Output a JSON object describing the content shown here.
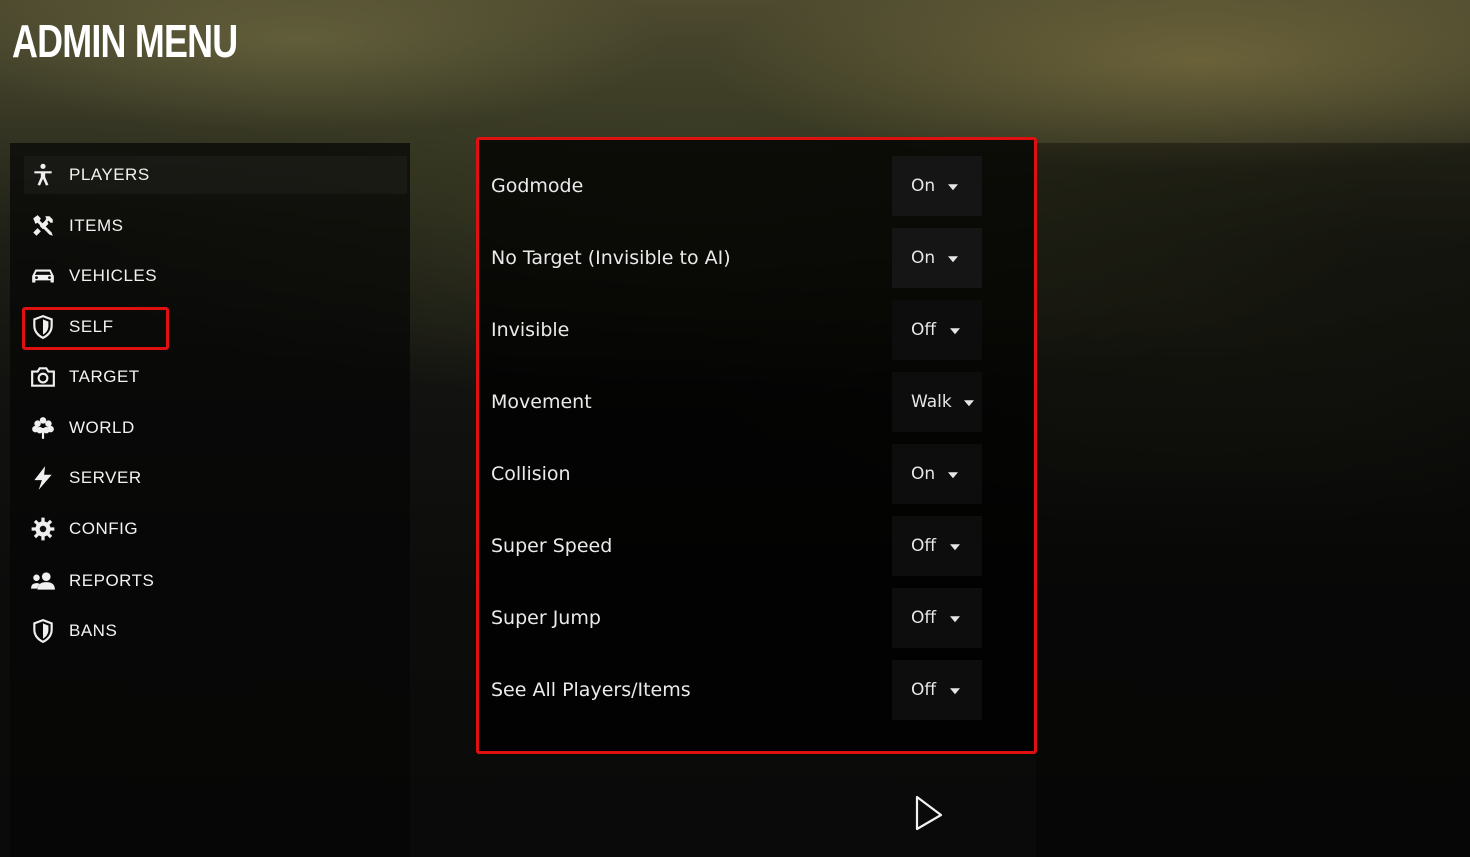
{
  "title": "ADMIN MENU",
  "nav": [
    {
      "label": "PLAYERS",
      "icon": "player-icon"
    },
    {
      "label": "ITEMS",
      "icon": "tools-icon"
    },
    {
      "label": "VEHICLES",
      "icon": "car-icon"
    },
    {
      "label": "SELF",
      "icon": "shield-icon"
    },
    {
      "label": "TARGET",
      "icon": "camera-icon"
    },
    {
      "label": "WORLD",
      "icon": "tree-icon"
    },
    {
      "label": "SERVER",
      "icon": "lightning-icon"
    },
    {
      "label": "CONFIG",
      "icon": "gear-icon"
    },
    {
      "label": "REPORTS",
      "icon": "users-icon"
    },
    {
      "label": "BANS",
      "icon": "shield-icon"
    }
  ],
  "selected_nav": "SELF",
  "options": [
    {
      "label": "Godmode",
      "value": "On"
    },
    {
      "label": "No Target (Invisible to AI)",
      "value": "On"
    },
    {
      "label": "Invisible",
      "value": "Off"
    },
    {
      "label": "Movement",
      "value": "Walk"
    },
    {
      "label": "Collision",
      "value": "On"
    },
    {
      "label": "Super Speed",
      "value": "Off"
    },
    {
      "label": "Super Jump",
      "value": "Off"
    },
    {
      "label": "See All Players/Items",
      "value": "Off"
    }
  ],
  "colors": {
    "highlight": "#e01010",
    "text": "#eaeaea"
  }
}
